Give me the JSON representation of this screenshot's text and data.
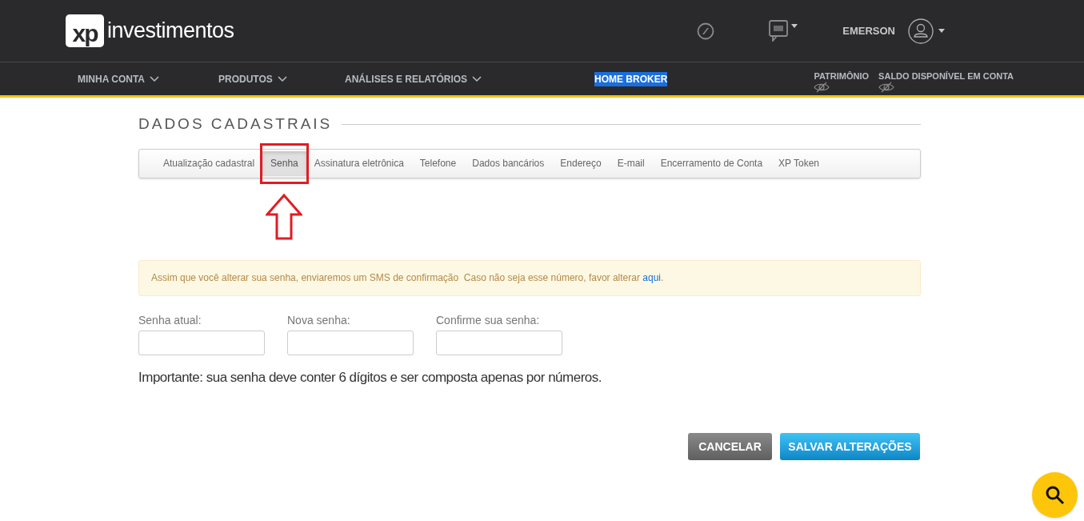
{
  "header": {
    "logo_mark": "xp",
    "logo_text": "investimentos",
    "user_name": "EMERSON"
  },
  "nav": {
    "menus": [
      {
        "label": "MINHA CONTA",
        "kind": "dropdown",
        "highlighted": false
      },
      {
        "label": "PRODUTOS",
        "kind": "dropdown",
        "highlighted": false
      },
      {
        "label": "ANÁLISES E RELATÓRIOS",
        "kind": "dropdown",
        "highlighted": false
      },
      {
        "label": "HOME BROKER",
        "kind": "link",
        "highlighted": true
      }
    ],
    "balances": [
      {
        "label": "PATRIMÔNIO",
        "hidden": true
      },
      {
        "label": "SALDO DISPONÍVEL EM CONTA",
        "hidden": true
      }
    ]
  },
  "page_title": "DADOS CADASTRAIS",
  "tabs": [
    {
      "label": "Atualização cadastral",
      "selected": false,
      "annotated": false
    },
    {
      "label": "Senha",
      "selected": true,
      "annotated": true
    },
    {
      "label": "Assinatura eletrônica",
      "selected": false,
      "annotated": false
    },
    {
      "label": "Telefone",
      "selected": false,
      "annotated": false
    },
    {
      "label": "Dados bancários",
      "selected": false,
      "annotated": false
    },
    {
      "label": "Endereço",
      "selected": false,
      "annotated": false
    },
    {
      "label": "E-mail",
      "selected": false,
      "annotated": false
    },
    {
      "label": "Encerramento de Conta",
      "selected": false,
      "annotated": false
    },
    {
      "label": "XP Token",
      "selected": false,
      "annotated": false
    }
  ],
  "alert": {
    "text": "Assim que você alterar sua senha, enviaremos um SMS de confirmação  Caso não seja esse número, favor alterar",
    "link": "aqui",
    "end": "."
  },
  "fields": [
    {
      "label": "Senha atual:"
    },
    {
      "label": "Nova senha:"
    },
    {
      "label": "Confirme sua senha:"
    }
  ],
  "note": "Importante: sua senha deve conter 6 dígitos e ser composta apenas por números.",
  "buttons": [
    {
      "label": "CANCELAR",
      "kind": "secondary"
    },
    {
      "label": "SALVAR ALTERAÇÕES",
      "kind": "primary"
    }
  ]
}
